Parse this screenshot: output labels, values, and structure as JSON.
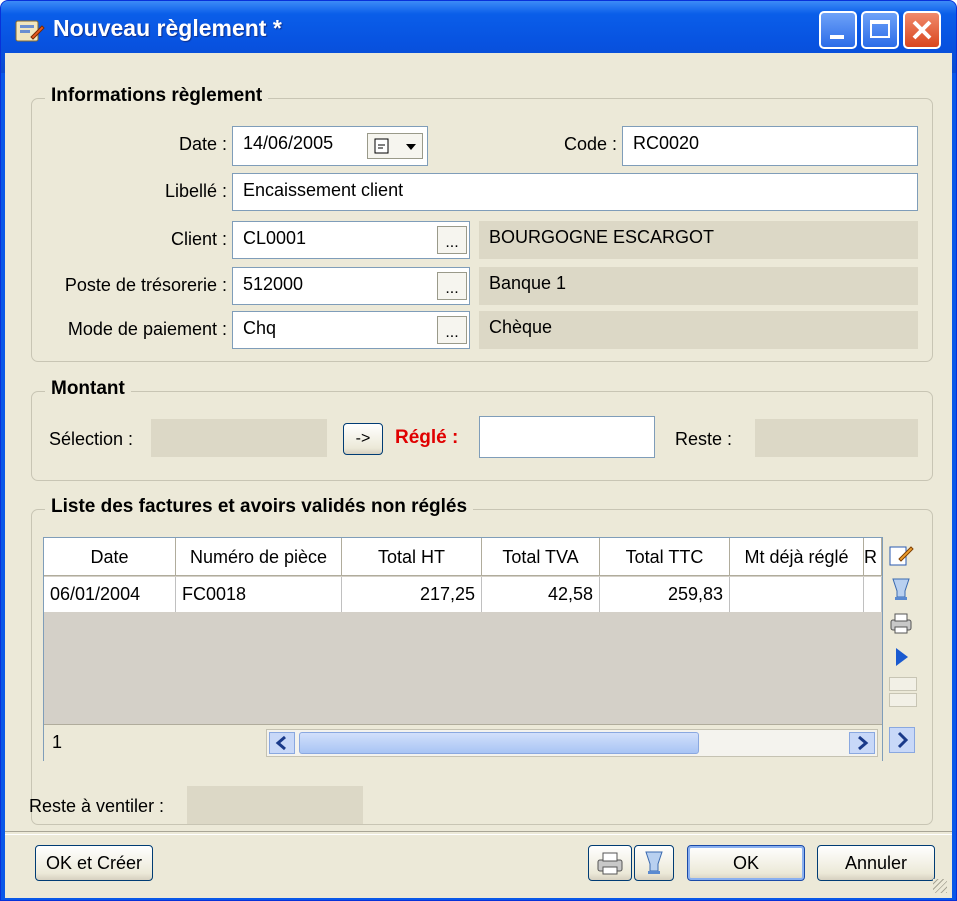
{
  "window": {
    "title": "Nouveau règlement *"
  },
  "info": {
    "legend": "Informations règlement",
    "date_label": "Date :",
    "date_value": "14/06/2005",
    "code_label": "Code :",
    "code_value": "RC0020",
    "libelle_label": "Libellé :",
    "libelle_value": "Encaissement client",
    "client_label": "Client :",
    "client_code": "CL0001",
    "client_name": "BOURGOGNE ESCARGOT",
    "poste_label": "Poste de trésorerie :",
    "poste_code": "512000",
    "poste_name": "Banque 1",
    "mode_label": "Mode de paiement :",
    "mode_code": "Chq",
    "mode_name": "Chèque",
    "dots": "..."
  },
  "montant": {
    "legend": "Montant",
    "selection_label": "Sélection :",
    "arrow_label": "->",
    "regle_label": "Réglé :",
    "regle_value": "",
    "reste_label": "Reste :"
  },
  "factures": {
    "legend": "Liste des factures et avoirs validés non réglés",
    "columns": [
      "Date",
      "Numéro de pièce",
      "Total HT",
      "Total TVA",
      "Total TTC",
      "Mt déjà réglé",
      "R"
    ],
    "rows": [
      {
        "date": "06/01/2004",
        "numero": "FC0018",
        "total_ht": "217,25",
        "total_tva": "42,58",
        "total_ttc": "259,83",
        "mt_deja_regle": ""
      }
    ],
    "row_count": "1"
  },
  "reste_ventiler_label": "Reste à ventiler :",
  "footer": {
    "ok_creer": "OK et Créer",
    "ok": "OK",
    "annuler": "Annuler"
  }
}
